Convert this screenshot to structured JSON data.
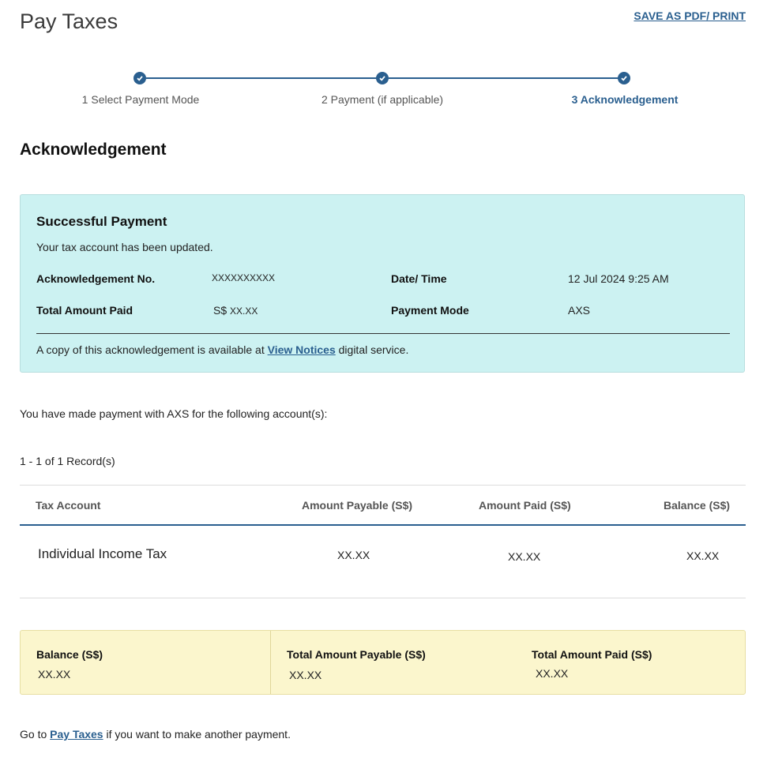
{
  "header": {
    "title": "Pay Taxes",
    "save_link": "SAVE AS PDF/ PRINT"
  },
  "stepper": {
    "steps": [
      {
        "label": "1 Select Payment Mode"
      },
      {
        "label": "2 Payment (if applicable)"
      },
      {
        "label": "3 Acknowledgement"
      }
    ]
  },
  "section_heading": "Acknowledgement",
  "success": {
    "title": "Successful Payment",
    "subtitle": "Your tax account has been updated.",
    "ack_no_label": "Acknowledgement No.",
    "ack_no_value": "XXXXXXXXXX",
    "datetime_label": "Date/ Time",
    "datetime_value": "12 Jul 2024 9:25 AM",
    "total_paid_label": "Total Amount Paid",
    "total_paid_currency": "S$",
    "total_paid_value": "XX.XX",
    "mode_label": "Payment Mode",
    "mode_value": "AXS",
    "note_prefix": "A copy of this acknowledgement is available at",
    "note_link": "View Notices",
    "note_suffix": "digital service."
  },
  "intro_text": "You have made payment with AXS for the following account(s):",
  "records_text": "1 - 1 of 1 Record(s)",
  "table": {
    "headers": [
      "Tax Account",
      "Amount Payable (S$)",
      "Amount Paid (S$)",
      "Balance (S$)"
    ],
    "rows": [
      {
        "account": "Individual Income Tax",
        "payable": "XX.XX",
        "paid": "XX.XX",
        "balance": "XX.XX"
      }
    ]
  },
  "summary": {
    "balance_label": "Balance (S$)",
    "balance_value": "XX.XX",
    "payable_label": "Total Amount Payable (S$)",
    "payable_value": "XX.XX",
    "paid_label": "Total Amount Paid (S$)",
    "paid_value": "XX.XX"
  },
  "footer": {
    "prefix": "Go to",
    "link": "Pay Taxes",
    "suffix": "if you want to make another payment."
  },
  "colors": {
    "accent": "#2a5f8f",
    "success_bg": "#ccf2f2",
    "summary_bg": "#fbf6cd"
  }
}
